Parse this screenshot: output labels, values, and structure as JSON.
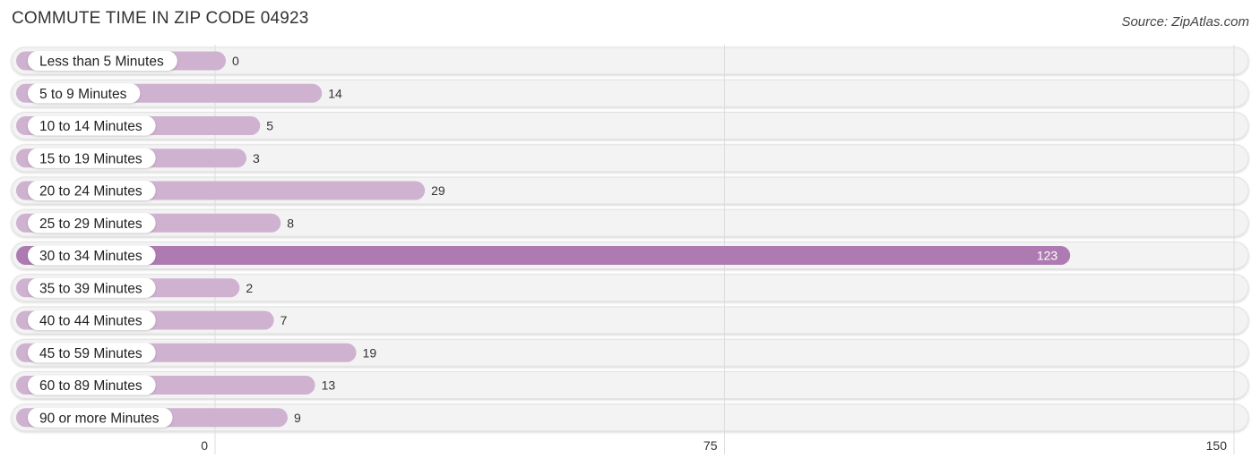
{
  "header": {
    "title": "COMMUTE TIME IN ZIP CODE 04923",
    "source": "Source: ZipAtlas.com"
  },
  "colors": {
    "bar_normal": "#cfb1d0",
    "bar_highlight": "#ad7bb1",
    "track": "#f3f3f3",
    "grid": "#dddddd"
  },
  "chart_data": {
    "type": "bar",
    "orientation": "horizontal",
    "title": "COMMUTE TIME IN ZIP CODE 04923",
    "xlabel": "",
    "ylabel": "",
    "categories": [
      "Less than 5 Minutes",
      "5 to 9 Minutes",
      "10 to 14 Minutes",
      "15 to 19 Minutes",
      "20 to 24 Minutes",
      "25 to 29 Minutes",
      "30 to 34 Minutes",
      "35 to 39 Minutes",
      "40 to 44 Minutes",
      "45 to 59 Minutes",
      "60 to 89 Minutes",
      "90 or more Minutes"
    ],
    "values": [
      0,
      14,
      5,
      3,
      29,
      8,
      123,
      2,
      7,
      19,
      13,
      9
    ],
    "highlight_index": 6,
    "xlim": [
      0,
      150
    ],
    "xticks": [
      0,
      75,
      150
    ],
    "xtick_labels": [
      "0",
      "75",
      "150"
    ],
    "grid": true,
    "legend": "none"
  }
}
